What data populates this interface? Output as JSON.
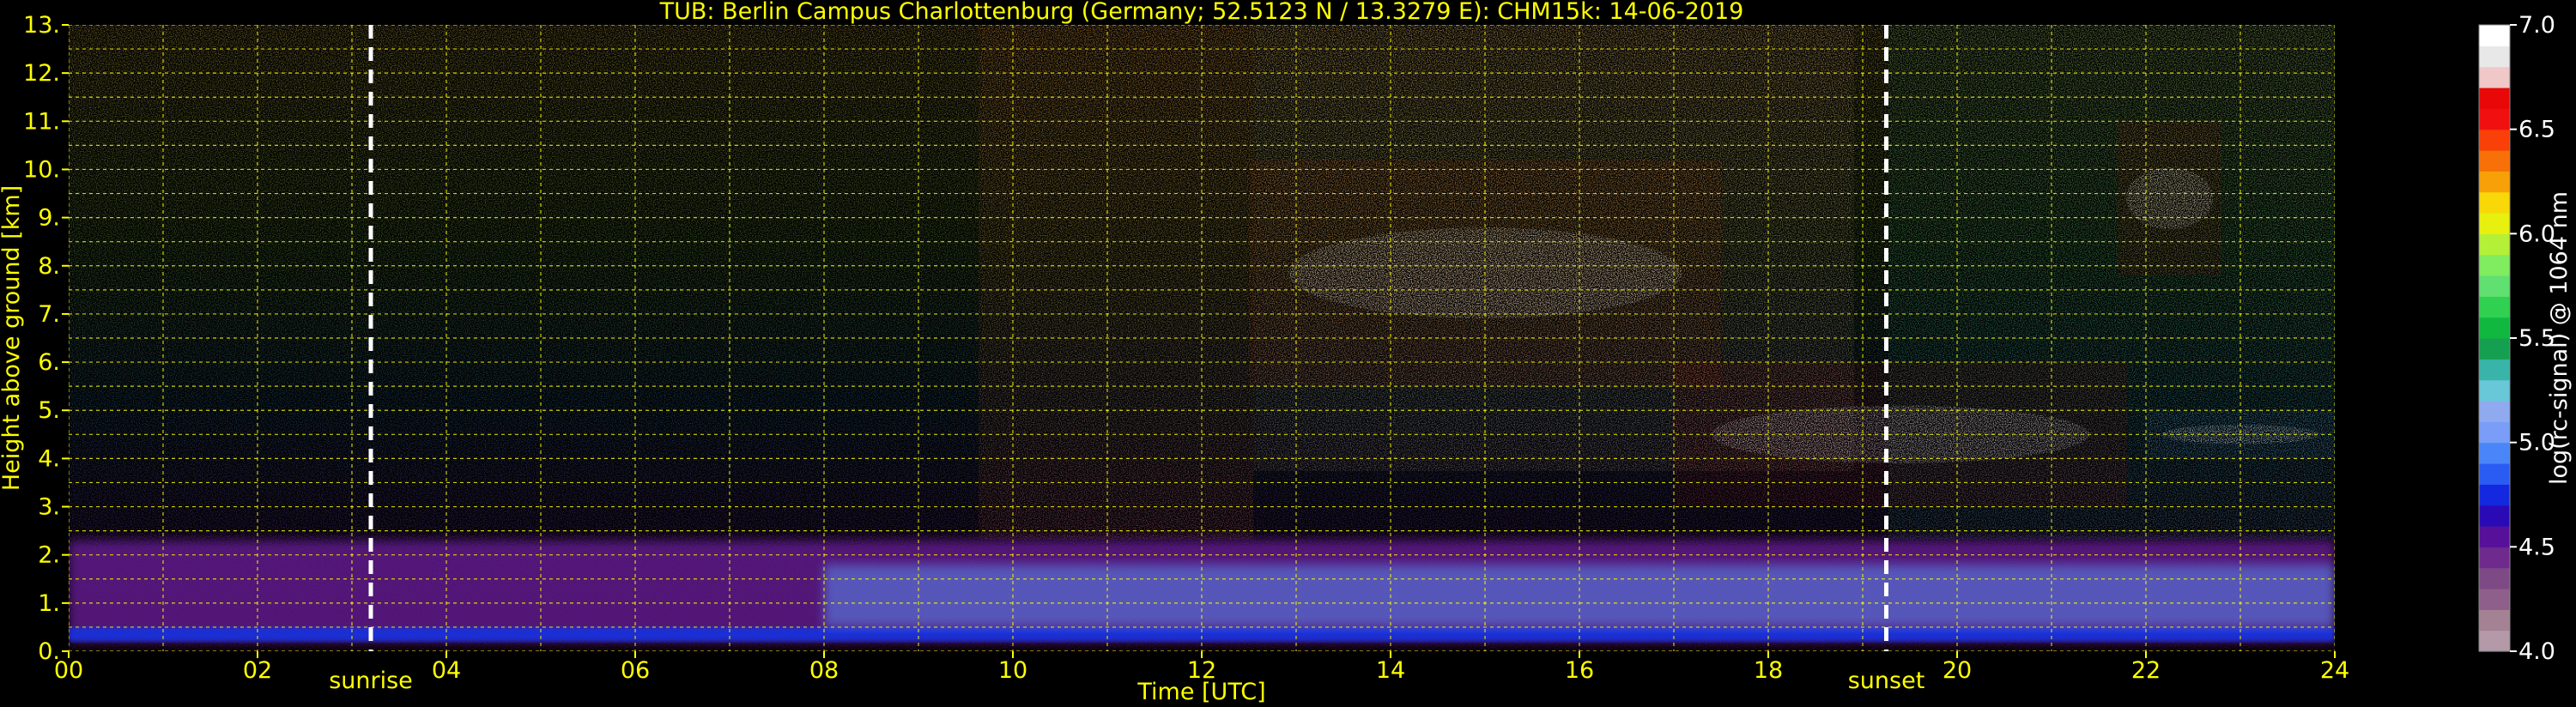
{
  "chart_data": {
    "type": "heatmap",
    "title": "TUB: Berlin Campus Charlottenburg (Germany; 52.5123 N / 13.3279 E):    CHM15k: 14-06-2019",
    "xlabel": "Time [UTC]",
    "ylabel": "Height above ground [km]",
    "xlim": [
      0,
      24
    ],
    "ylim": [
      0,
      13
    ],
    "x_ticks": [
      "00",
      "02",
      "04",
      "06",
      "08",
      "10",
      "12",
      "14",
      "16",
      "18",
      "20",
      "22",
      "24"
    ],
    "y_ticks": [
      "0.",
      "1.",
      "2.",
      "3.",
      "4.",
      "5.",
      "6.",
      "7.",
      "8.",
      "9.",
      "10.",
      "11.",
      "12.",
      "13."
    ],
    "grid": true,
    "markers": [
      {
        "label": "sunrise",
        "time_utc": 3.2
      },
      {
        "label": "sunset",
        "time_utc": 19.25
      }
    ],
    "colorbar": {
      "label": "log(rc-signal) @ 1064 nm",
      "range": [
        4.0,
        7.0
      ],
      "ticks": [
        "4.0",
        "4.5",
        "5.0",
        "5.5",
        "6.0",
        "6.5",
        "7.0"
      ],
      "colors": [
        "#b49aa8",
        "#a48294",
        "#8e5f8a",
        "#7e4a86",
        "#6e2a8c",
        "#56109a",
        "#2a0ab4",
        "#1428e0",
        "#2a5cf4",
        "#4a86f8",
        "#7a9ef8",
        "#90aaf0",
        "#68c8d8",
        "#38b4a8",
        "#14a050",
        "#10b840",
        "#30d050",
        "#60e070",
        "#80ec60",
        "#b4f038",
        "#e8f010",
        "#f8d808",
        "#f8a008",
        "#f87008",
        "#f84008",
        "#f01010",
        "#e80808",
        "#f0c8c8",
        "#e8e8e8",
        "#ffffff"
      ]
    },
    "features": [
      {
        "type": "boundary_layer",
        "t_start": 0,
        "t_end": 24,
        "z_base_km": 0.2,
        "z_top_km": 2.3
      },
      {
        "type": "cirrus",
        "t_start": 12.5,
        "t_end": 17.5,
        "z_base_km": 5.5,
        "z_top_km": 10.2
      },
      {
        "type": "cloud",
        "t_start": 17.0,
        "t_end": 21.8,
        "z_base_km": 3.0,
        "z_top_km": 6.0
      },
      {
        "type": "cloud",
        "t_start": 21.7,
        "t_end": 22.8,
        "z_base_km": 7.8,
        "z_top_km": 11.0
      },
      {
        "type": "cloud_layer",
        "t_start": 22.0,
        "t_end": 24.0,
        "z_base_km": 4.0,
        "z_top_km": 5.0
      }
    ]
  },
  "palette": {
    "text": "#ffff00",
    "grid": "#ffff00",
    "marker": "#ffffff",
    "background": "#000000"
  }
}
